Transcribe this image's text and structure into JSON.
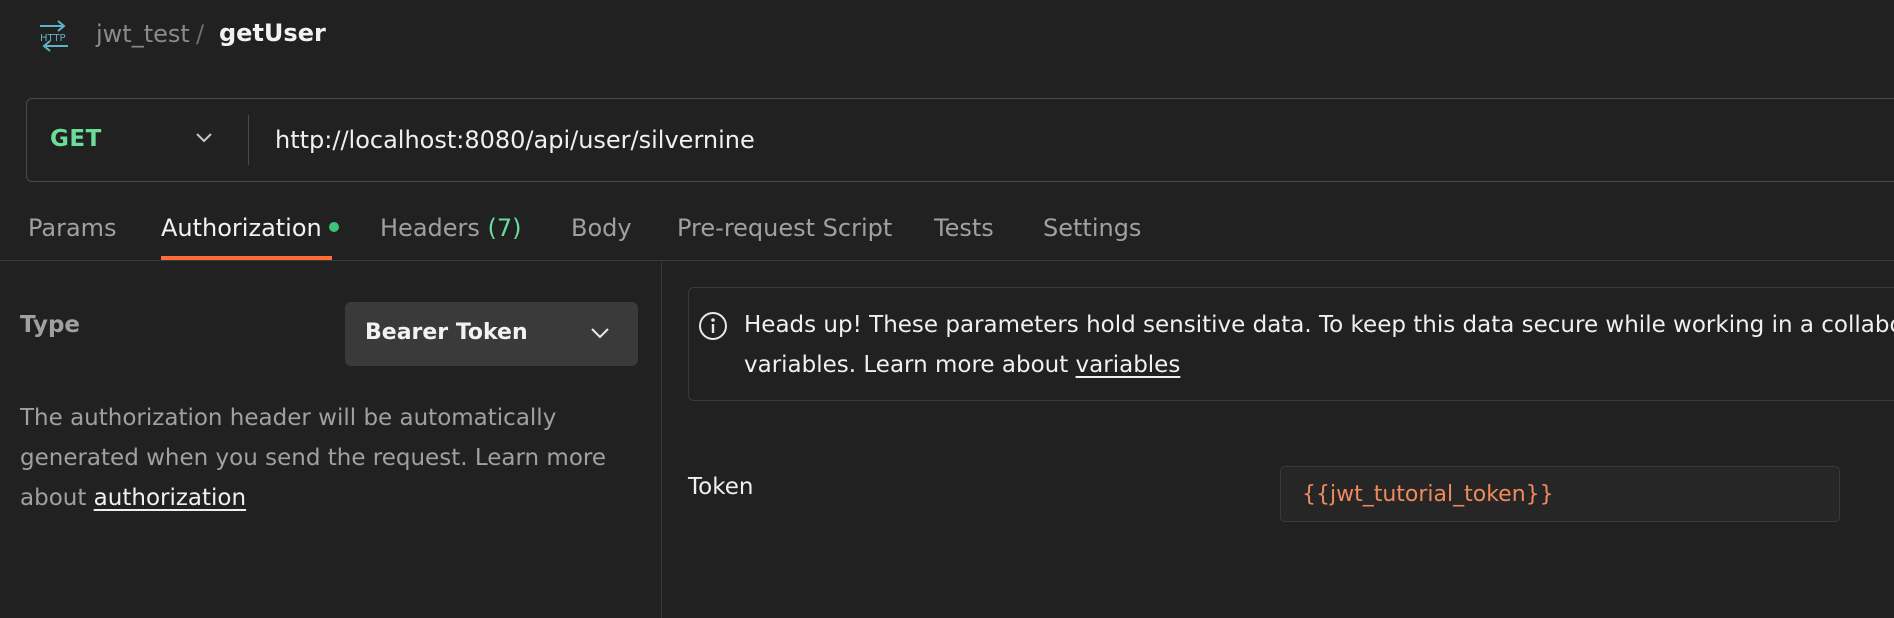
{
  "breadcrumb": {
    "icon": "http-icon",
    "collection": "jwt_test",
    "separator": "/",
    "request": "getUser"
  },
  "request": {
    "method": "GET",
    "url": "http://localhost:8080/api/user/silvernine"
  },
  "tabs": [
    {
      "label": "Params"
    },
    {
      "label": "Authorization",
      "active": true,
      "indicator": "green-dot"
    },
    {
      "label": "Headers",
      "count": "(7)"
    },
    {
      "label": "Body"
    },
    {
      "label": "Pre-request Script"
    },
    {
      "label": "Tests"
    },
    {
      "label": "Settings"
    }
  ],
  "auth": {
    "type_label": "Type",
    "type_value": "Bearer Token",
    "description": "The authorization header will be automatically generated when you send the request. Learn more about ",
    "description_link": "authorization"
  },
  "notice": {
    "line1": "Heads up! These parameters hold sensitive data. To keep this data secure while working in a collabora",
    "line2": "variables. Learn more about ",
    "link": "variables"
  },
  "token": {
    "label": "Token",
    "value": "{{jwt_tutorial_token}}"
  },
  "colors": {
    "background": "#212121",
    "method_get": "#6bdd9a",
    "accent": "#ff6c37",
    "variable": "#f08a5d",
    "status_dot": "#3ec27a"
  }
}
